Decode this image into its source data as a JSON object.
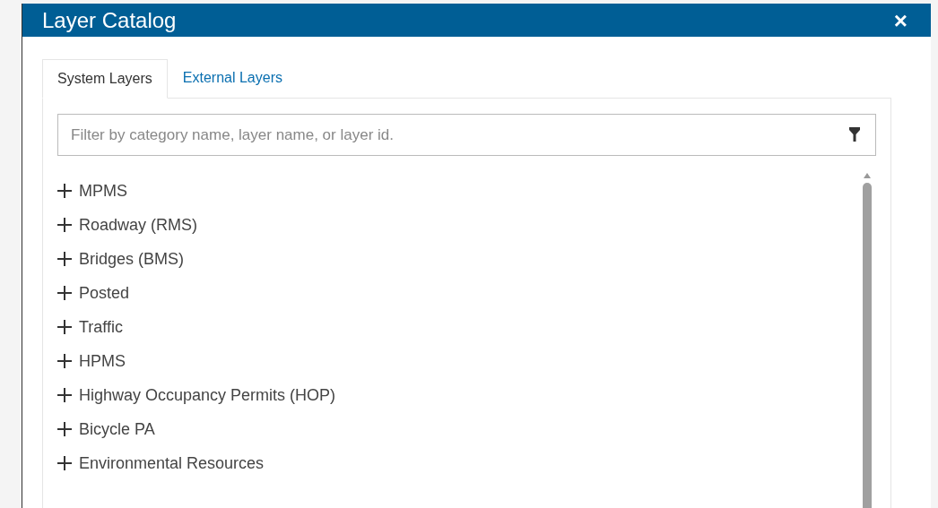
{
  "dialog": {
    "title": "Layer Catalog",
    "close": "×"
  },
  "tabs": [
    {
      "label": "System Layers",
      "selected": true
    },
    {
      "label": "External Layers",
      "selected": false
    }
  ],
  "filter": {
    "placeholder": "Filter by category name, layer name, or layer id."
  },
  "categories": [
    {
      "label": "MPMS",
      "expanded": false
    },
    {
      "label": "Roadway (RMS)",
      "expanded": false
    },
    {
      "label": "Bridges (BMS)",
      "expanded": false
    },
    {
      "label": "Posted",
      "expanded": false
    },
    {
      "label": "Traffic",
      "expanded": false
    },
    {
      "label": "HPMS",
      "expanded": false
    },
    {
      "label": "Highway Occupancy Permits (HOP)",
      "expanded": false
    },
    {
      "label": "Bicycle PA",
      "expanded": false
    },
    {
      "label": "Environmental Resources",
      "expanded": false
    }
  ]
}
